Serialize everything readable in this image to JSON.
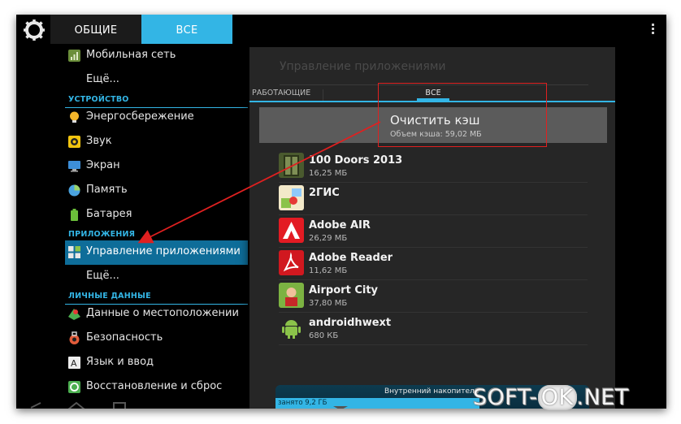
{
  "top_tabs": {
    "general": "ОБЩИЕ",
    "all": "ВСЕ"
  },
  "sidebar": {
    "items_top": [
      {
        "label": "Мобильная сеть",
        "icon": "signal-icon"
      },
      {
        "label": "Ещё...",
        "icon": ""
      }
    ],
    "section_device": "УСТРОЙСТВО",
    "items_device": [
      {
        "label": "Энергосбережение",
        "icon": "bulb-icon"
      },
      {
        "label": "Звук",
        "icon": "speaker-icon"
      },
      {
        "label": "Экран",
        "icon": "monitor-icon"
      },
      {
        "label": "Память",
        "icon": "pie-icon"
      },
      {
        "label": "Батарея",
        "icon": "battery-icon"
      }
    ],
    "section_apps": "ПРИЛОЖЕНИЯ",
    "items_apps": [
      {
        "label": "Управление приложениями",
        "icon": "apps-grid-icon",
        "selected": true
      },
      {
        "label": "Ещё...",
        "icon": ""
      }
    ],
    "section_personal": "ЛИЧНЫЕ ДАННЫЕ",
    "items_personal": [
      {
        "label": "Данные о местоположении",
        "icon": "location-icon"
      },
      {
        "label": "Безопасность",
        "icon": "lock-icon"
      },
      {
        "label": "Язык и ввод",
        "icon": "keyboard-icon"
      },
      {
        "label": "Восстановление и сброс",
        "icon": "restore-icon"
      }
    ]
  },
  "dialog": {
    "title": "Управление приложениями",
    "tab_running": "РАБОТАЮЩИЕ",
    "tab_all": "ВСЕ",
    "clear_cache": "Очистить кэш",
    "cache_size": "Объем кэша: 59,02 МБ",
    "apps": [
      {
        "name": "100 Doors 2013",
        "size": "16,25 МБ",
        "icon": "doors-app-icon"
      },
      {
        "name": "2ГИС",
        "size": "",
        "icon": "map-app-icon"
      },
      {
        "name": "Adobe AIR",
        "size": "26,29 МБ",
        "icon": "adobe-air-icon"
      },
      {
        "name": "Adobe Reader",
        "size": "11,62 МБ",
        "icon": "adobe-reader-icon"
      },
      {
        "name": "Airport City",
        "size": "37,80 МБ",
        "icon": "airport-city-icon"
      },
      {
        "name": "androidhwext",
        "size": "680 КБ",
        "icon": "android-robot-icon"
      }
    ],
    "storage_label": "Внутренний накопитель",
    "storage_used": "занято 9,2 ГБ",
    "storage_used_fraction": 0.65
  },
  "colors": {
    "accent": "#33b5e5",
    "highlight": "#e02020",
    "selected": "#0e6d99"
  },
  "watermark": {
    "pre": "SOFT-",
    "ok": "OK",
    "post": ".NET"
  }
}
